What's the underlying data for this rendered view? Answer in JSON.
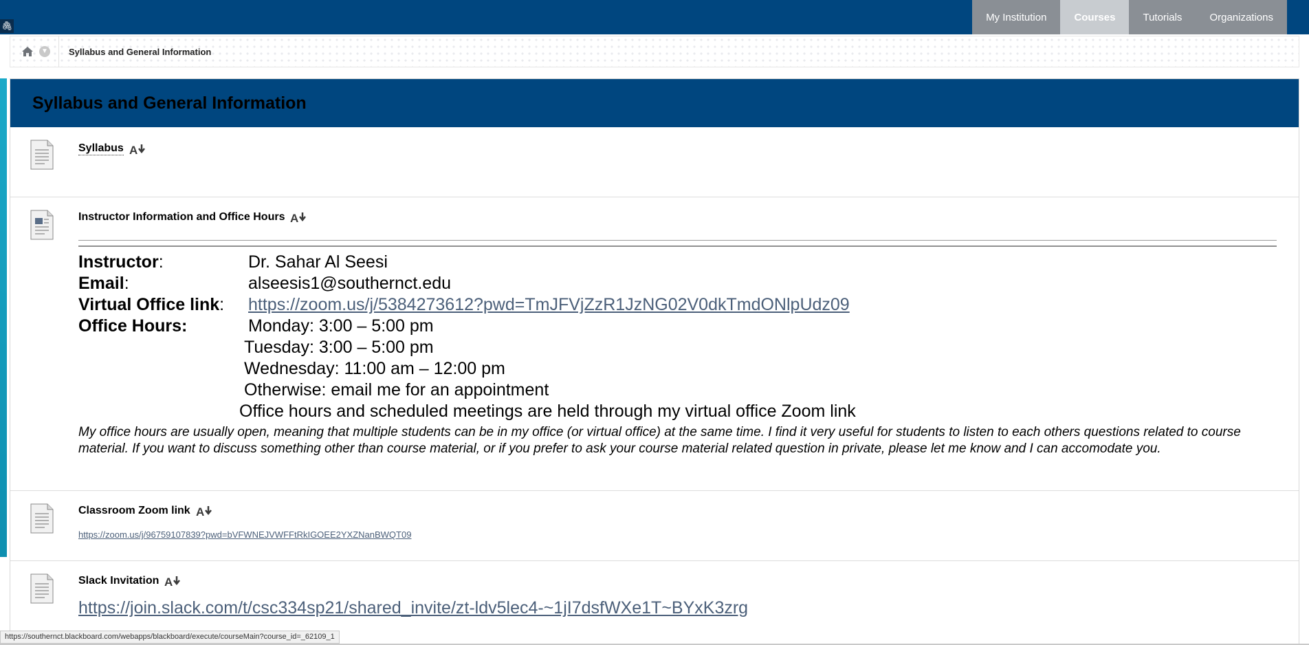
{
  "nav": {
    "tabs": [
      {
        "label": "My Institution"
      },
      {
        "label": "Courses",
        "active": true
      },
      {
        "label": "Tutorials"
      },
      {
        "label": "Organizations"
      }
    ]
  },
  "breadcrumb": {
    "current": "Syllabus and General Information"
  },
  "page": {
    "title": "Syllabus and General Information"
  },
  "items": {
    "syllabus": {
      "title": "Syllabus"
    },
    "instructor": {
      "title": "Instructor Information and Office Hours",
      "instructor_label": "Instructor",
      "instructor_value": "Dr. Sahar Al Seesi",
      "email_label": "Email",
      "email_value": "alseesis1@southernct.edu",
      "virtual_label": "Virtual Office link",
      "virtual_link": "https://zoom.us/j/5384273612?pwd=TmJFVjZzR1JzNG02V0dkTmdONlpUdz09",
      "hours_label": "Office Hours:",
      "hours": [
        "Monday: 3:00 – 5:00 pm",
        "Tuesday: 3:00 – 5:00 pm",
        "Wednesday: 11:00 am – 12:00 pm",
        "Otherwise: email me for an appointment",
        "Office hours and scheduled meetings are held through my virtual office Zoom link"
      ],
      "note": "My office hours are usually open, meaning that multiple students can be in my office (or virtual office) at the same time. I find it very useful for students to listen to each others questions related to course material. If you want to discuss something other than course material, or if you prefer to ask your course material related question in private, please let me know and I can accomodate you."
    },
    "classroom": {
      "title": "Classroom Zoom link",
      "link": "https://zoom.us/j/96759107839?pwd=bVFWNEJVWFFtRkIGOEE2YXZNanBWQT09"
    },
    "slack": {
      "title": "Slack Invitation",
      "link": "https://join.slack.com/t/csc334sp21/shared_invite/zt-ldv5lec4-~1jI7dsfWXe1T~BYxK3zrg"
    }
  },
  "status_bar": {
    "url": "https://southernct.blackboard.com/webapps/blackboard/execute/courseMain?course_id=_62109_1"
  },
  "colors": {
    "header": "#00467f",
    "tab": "#8a8f95",
    "tab_active": "#c8ccd0",
    "link": "#4b5f79",
    "accent": "#1aa9c8"
  }
}
